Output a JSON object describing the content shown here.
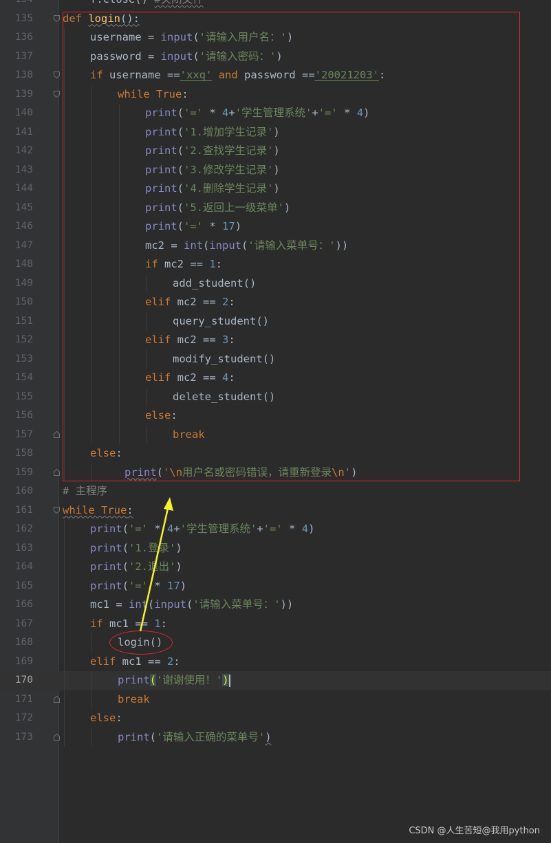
{
  "editor": {
    "current_line": "170",
    "lines": [
      {
        "num": "134",
        "tokens": [
          [
            "f.close() ",
            "d"
          ],
          [
            "#关闭文件",
            "cm wavy"
          ]
        ]
      },
      {
        "num": "135",
        "tokens": [
          [
            "def ",
            "kw"
          ],
          [
            "login",
            "fn wavy"
          ],
          [
            "():",
            "d wavy"
          ]
        ]
      },
      {
        "num": "136",
        "tokens": [
          [
            "username = ",
            "d"
          ],
          [
            "input",
            "bi"
          ],
          [
            "(",
            "d"
          ],
          [
            "'请输入用户名：'",
            "st"
          ],
          [
            ")",
            "d"
          ]
        ]
      },
      {
        "num": "137",
        "tokens": [
          [
            "password = ",
            "d"
          ],
          [
            "input",
            "bi"
          ],
          [
            "(",
            "d"
          ],
          [
            "'请输入密码：'",
            "st"
          ],
          [
            ")",
            "d"
          ]
        ]
      },
      {
        "num": "138",
        "tokens": [
          [
            "if ",
            "kw"
          ],
          [
            "username ==",
            "d"
          ],
          [
            "'xxq'",
            "st uline"
          ],
          [
            " and ",
            "kw"
          ],
          [
            "password ==",
            "d"
          ],
          [
            "'20021203'",
            "st uline"
          ],
          [
            ":",
            "d"
          ]
        ]
      },
      {
        "num": "139",
        "tokens": [
          [
            "while ",
            "kw"
          ],
          [
            "True",
            "kw"
          ],
          [
            ":",
            "d"
          ]
        ]
      },
      {
        "num": "140",
        "tokens": [
          [
            "print",
            "bi"
          ],
          [
            "(",
            "d"
          ],
          [
            "'='",
            "st"
          ],
          [
            " * ",
            "d"
          ],
          [
            "4",
            "nm"
          ],
          [
            "+",
            "d"
          ],
          [
            "'学生管理系统'",
            "st"
          ],
          [
            "+",
            "d"
          ],
          [
            "'='",
            "st"
          ],
          [
            " * ",
            "d"
          ],
          [
            "4",
            "nm"
          ],
          [
            ")",
            "d"
          ]
        ]
      },
      {
        "num": "141",
        "tokens": [
          [
            "print",
            "bi"
          ],
          [
            "(",
            "d"
          ],
          [
            "'1.增加学生记录'",
            "st"
          ],
          [
            ")",
            "d"
          ]
        ]
      },
      {
        "num": "142",
        "tokens": [
          [
            "print",
            "bi"
          ],
          [
            "(",
            "d"
          ],
          [
            "'2.查找学生记录'",
            "st"
          ],
          [
            ")",
            "d"
          ]
        ]
      },
      {
        "num": "143",
        "tokens": [
          [
            "print",
            "bi"
          ],
          [
            "(",
            "d"
          ],
          [
            "'3.修改学生记录'",
            "st"
          ],
          [
            ")",
            "d"
          ]
        ]
      },
      {
        "num": "144",
        "tokens": [
          [
            "print",
            "bi"
          ],
          [
            "(",
            "d"
          ],
          [
            "'4.删除学生记录'",
            "st"
          ],
          [
            ")",
            "d"
          ]
        ]
      },
      {
        "num": "145",
        "tokens": [
          [
            "print",
            "bi"
          ],
          [
            "(",
            "d"
          ],
          [
            "'5.返回上一级菜单'",
            "st"
          ],
          [
            ")",
            "d"
          ]
        ]
      },
      {
        "num": "146",
        "tokens": [
          [
            "print",
            "bi"
          ],
          [
            "(",
            "d"
          ],
          [
            "'='",
            "st"
          ],
          [
            " * ",
            "d"
          ],
          [
            "17",
            "nm"
          ],
          [
            ")",
            "d"
          ]
        ]
      },
      {
        "num": "147",
        "tokens": [
          [
            "mc2 = ",
            "d"
          ],
          [
            "int",
            "bi"
          ],
          [
            "(",
            "d"
          ],
          [
            "input",
            "bi"
          ],
          [
            "(",
            "d"
          ],
          [
            "'请输入菜单号：'",
            "st"
          ],
          [
            "))",
            "d"
          ]
        ]
      },
      {
        "num": "148",
        "tokens": [
          [
            "if ",
            "kw"
          ],
          [
            "mc2 == ",
            "d"
          ],
          [
            "1",
            "nm"
          ],
          [
            ":",
            "d"
          ]
        ]
      },
      {
        "num": "149",
        "tokens": [
          [
            "add_student()",
            "d"
          ]
        ]
      },
      {
        "num": "150",
        "tokens": [
          [
            "elif ",
            "kw"
          ],
          [
            "mc2 == ",
            "d"
          ],
          [
            "2",
            "nm"
          ],
          [
            ":",
            "d"
          ]
        ]
      },
      {
        "num": "151",
        "tokens": [
          [
            "query_student()",
            "d"
          ]
        ]
      },
      {
        "num": "152",
        "tokens": [
          [
            "elif ",
            "kw"
          ],
          [
            "mc2 == ",
            "d"
          ],
          [
            "3",
            "nm"
          ],
          [
            ":",
            "d"
          ]
        ]
      },
      {
        "num": "153",
        "tokens": [
          [
            "modify_student()",
            "d"
          ]
        ]
      },
      {
        "num": "154",
        "tokens": [
          [
            "elif ",
            "kw"
          ],
          [
            "mc2 == ",
            "d"
          ],
          [
            "4",
            "nm"
          ],
          [
            ":",
            "d"
          ]
        ]
      },
      {
        "num": "155",
        "tokens": [
          [
            "delete_student()",
            "d"
          ]
        ]
      },
      {
        "num": "156",
        "tokens": [
          [
            "else",
            "kw"
          ],
          [
            ":",
            "d"
          ]
        ]
      },
      {
        "num": "157",
        "tokens": [
          [
            "break",
            "kw"
          ]
        ]
      },
      {
        "num": "158",
        "tokens": [
          [
            "else",
            "kw"
          ],
          [
            ":",
            "d"
          ]
        ]
      },
      {
        "num": "159",
        "tokens": [
          [
            "print",
            "bi wavy"
          ],
          [
            "(",
            "d"
          ],
          [
            "'",
            "st"
          ],
          [
            "\\n",
            "esc"
          ],
          [
            "用户名或密码错误，请重新登录",
            "st"
          ],
          [
            "\\n",
            "esc"
          ],
          [
            "'",
            "st"
          ],
          [
            ")",
            "d"
          ]
        ]
      },
      {
        "num": "160",
        "tokens": [
          [
            "# 主程序",
            "cm"
          ]
        ]
      },
      {
        "num": "161",
        "tokens": [
          [
            "while ",
            "kw wavy"
          ],
          [
            "True",
            "kw wavy"
          ],
          [
            ":",
            "d wavy"
          ]
        ]
      },
      {
        "num": "162",
        "tokens": [
          [
            "print",
            "bi"
          ],
          [
            "(",
            "d"
          ],
          [
            "'='",
            "st"
          ],
          [
            " * ",
            "d"
          ],
          [
            "4",
            "nm"
          ],
          [
            "+",
            "d"
          ],
          [
            "'学生管理系统'",
            "st"
          ],
          [
            "+",
            "d"
          ],
          [
            "'='",
            "st"
          ],
          [
            " * ",
            "d"
          ],
          [
            "4",
            "nm"
          ],
          [
            ")",
            "d"
          ]
        ]
      },
      {
        "num": "163",
        "tokens": [
          [
            "print",
            "bi"
          ],
          [
            "(",
            "d"
          ],
          [
            "'1.登录'",
            "st"
          ],
          [
            ")",
            "d"
          ]
        ]
      },
      {
        "num": "164",
        "tokens": [
          [
            "print",
            "bi"
          ],
          [
            "(",
            "d"
          ],
          [
            "'2.退出'",
            "st"
          ],
          [
            ")",
            "d"
          ]
        ]
      },
      {
        "num": "165",
        "tokens": [
          [
            "print",
            "bi"
          ],
          [
            "(",
            "d"
          ],
          [
            "'='",
            "st"
          ],
          [
            " * ",
            "d"
          ],
          [
            "17",
            "nm"
          ],
          [
            ")",
            "d"
          ]
        ]
      },
      {
        "num": "166",
        "tokens": [
          [
            "mc1 = ",
            "d"
          ],
          [
            "int",
            "bi"
          ],
          [
            "(",
            "d"
          ],
          [
            "input",
            "bi"
          ],
          [
            "(",
            "d"
          ],
          [
            "'请输入菜单号：'",
            "st"
          ],
          [
            "))",
            "d"
          ]
        ]
      },
      {
        "num": "167",
        "tokens": [
          [
            "if ",
            "kw"
          ],
          [
            "mc1 == ",
            "d"
          ],
          [
            "1",
            "nm"
          ],
          [
            ":",
            "d"
          ]
        ]
      },
      {
        "num": "168",
        "tokens": [
          [
            "login()",
            "d"
          ]
        ]
      },
      {
        "num": "169",
        "tokens": [
          [
            "elif ",
            "kw"
          ],
          [
            "mc1 == ",
            "d"
          ],
          [
            "2",
            "nm"
          ],
          [
            ":",
            "d"
          ]
        ]
      },
      {
        "num": "170",
        "tokens": [
          [
            "print",
            "bi"
          ],
          [
            "(",
            "brace-hl"
          ],
          [
            "'谢谢使用！'",
            "st"
          ],
          [
            ")",
            "brace-hl"
          ]
        ]
      },
      {
        "num": "171",
        "tokens": [
          [
            "break",
            "kw"
          ]
        ]
      },
      {
        "num": "172",
        "tokens": [
          [
            "else",
            "kw"
          ],
          [
            ":",
            "d"
          ]
        ]
      },
      {
        "num": "173",
        "tokens": [
          [
            "print",
            "bi"
          ],
          [
            "(",
            "d"
          ],
          [
            "'请输入正确的菜单号'",
            "st"
          ],
          [
            ")",
            "d wavy"
          ]
        ]
      }
    ]
  },
  "watermark": "CSDN @人生苦短@我用python"
}
